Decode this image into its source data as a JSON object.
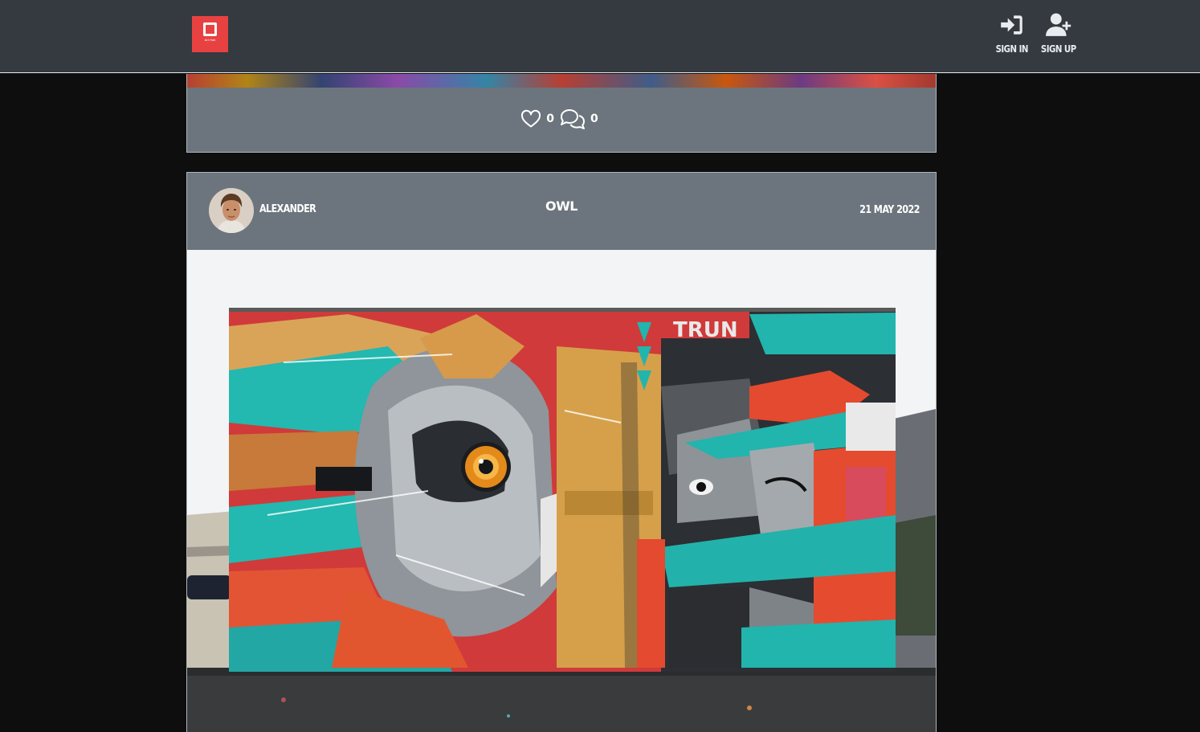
{
  "brand": {
    "logo_text": "Art Hub",
    "color": "#e84142"
  },
  "nav": {
    "sign_in": "SIGN IN",
    "sign_up": "SIGN UP",
    "sign_in_icon": "sign-in-icon",
    "sign_up_icon": "user-plus-icon"
  },
  "previous_post": {
    "likes": "0",
    "comments": "0"
  },
  "post": {
    "author": "ALEXANDER",
    "title": "OWL",
    "date": "21 MAY 2022",
    "image_subject": "owl-mural"
  },
  "colors": {
    "navbar": "#343a40",
    "card": "#6c757d",
    "page": "#0e0e0e"
  }
}
